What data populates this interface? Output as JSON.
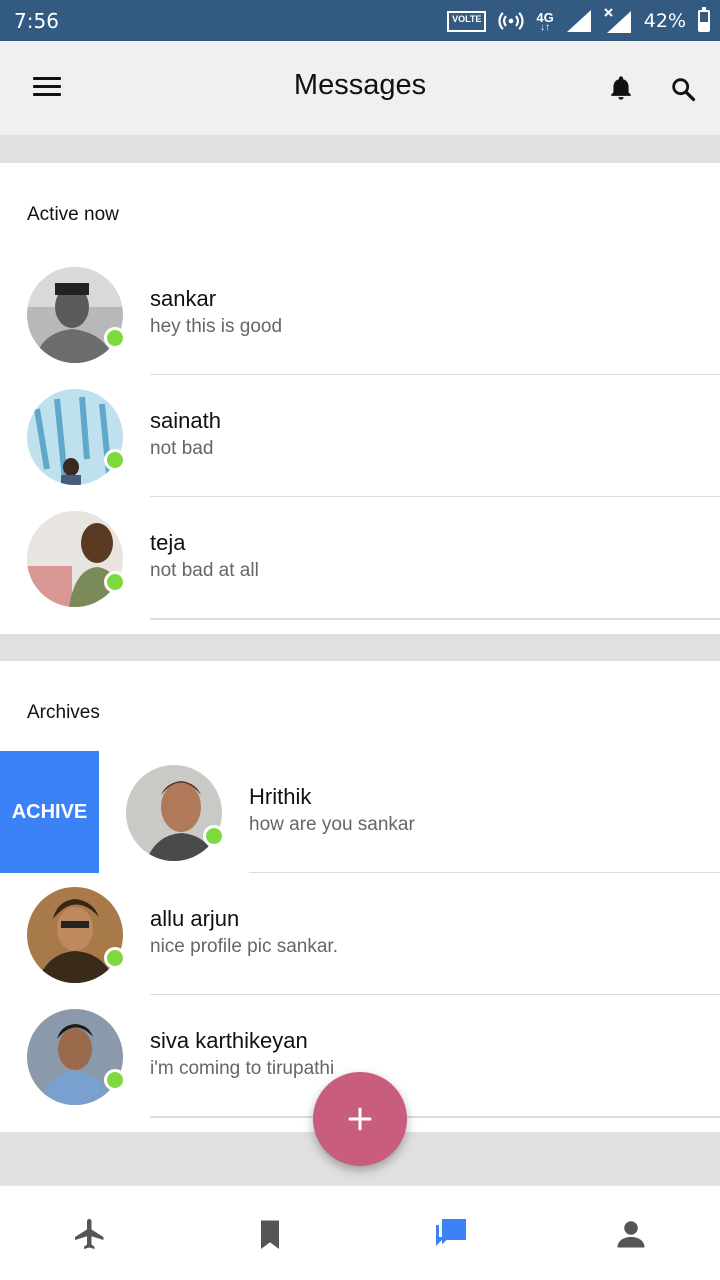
{
  "status_bar": {
    "time": "7:56",
    "volte": "VOLTE",
    "network": "4G",
    "battery": "42%",
    "battery_level": 0.42
  },
  "app_bar": {
    "title": "Messages"
  },
  "sections": {
    "active": {
      "title": "Active now"
    },
    "archives": {
      "title": "Archives"
    }
  },
  "active_contacts": [
    {
      "name": "sankar",
      "message": "hey this is good"
    },
    {
      "name": "sainath",
      "message": "not bad"
    },
    {
      "name": "teja",
      "message": "not bad at all"
    }
  ],
  "archived_contacts": [
    {
      "name": "Hrithik",
      "message": "how are you sankar"
    },
    {
      "name": "allu arjun",
      "message": "nice profile pic sankar."
    },
    {
      "name": "siva karthikeyan",
      "message": "i'm coming to tirupathi"
    }
  ],
  "swipe_action": {
    "label": "ACHIVE",
    "color": "#3b82f6"
  },
  "colors": {
    "status_bar": "#335a80",
    "online": "#7ed93f",
    "fab": "#c85d7e",
    "accent": "#3b82f6"
  },
  "bottom_nav": [
    {
      "icon": "airplane-icon",
      "active": false
    },
    {
      "icon": "bookmark-icon",
      "active": false
    },
    {
      "icon": "chat-icon",
      "active": true
    },
    {
      "icon": "person-icon",
      "active": false
    }
  ]
}
